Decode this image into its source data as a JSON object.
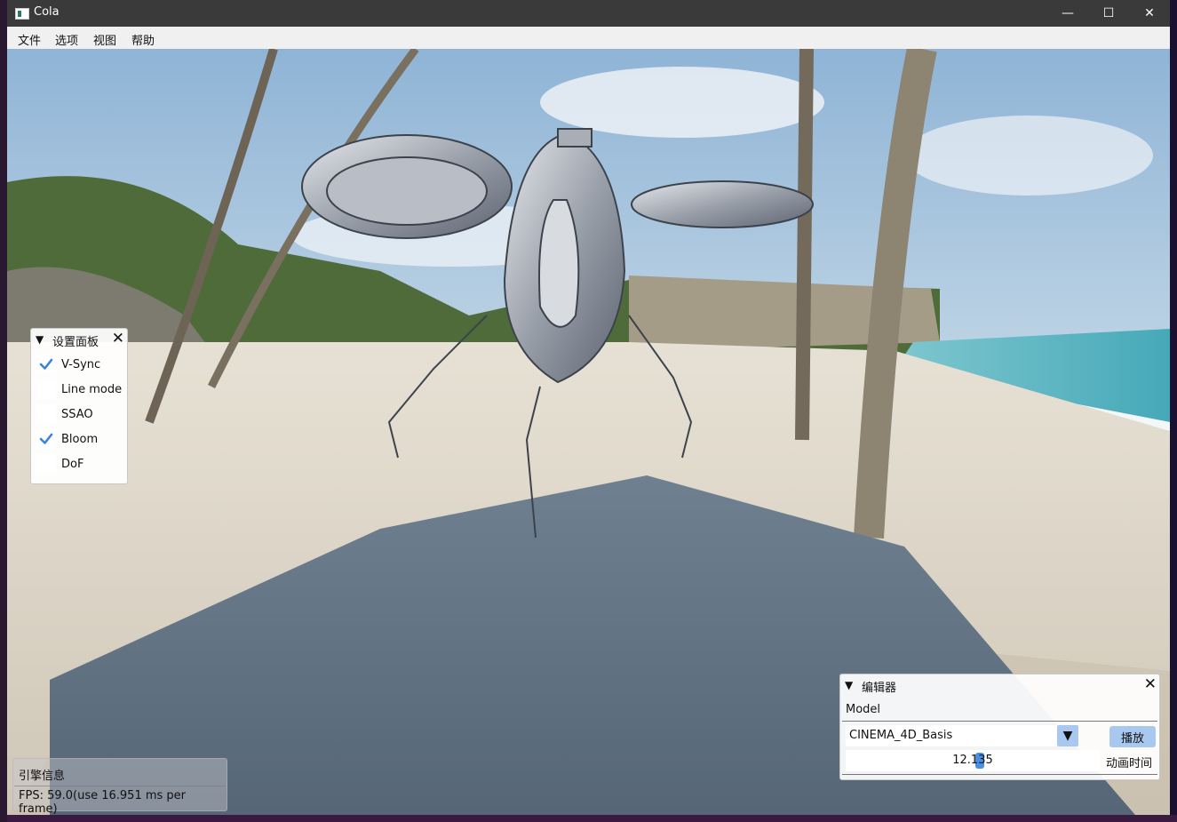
{
  "window": {
    "title": "Cola",
    "minimize_glyph": "—",
    "maximize_glyph": "☐",
    "close_glyph": "✕"
  },
  "menu": [
    "文件",
    "选项",
    "视图",
    "帮助"
  ],
  "settings_panel": {
    "title": "设置面板",
    "items": [
      {
        "label": "V-Sync",
        "checked": true
      },
      {
        "label": "Line mode",
        "checked": false
      },
      {
        "label": "SSAO",
        "checked": false
      },
      {
        "label": "Bloom",
        "checked": true
      },
      {
        "label": "DoF",
        "checked": false
      }
    ]
  },
  "editor_panel": {
    "title": "编辑器",
    "model_label": "Model",
    "model_selected": "CINEMA_4D_Basis",
    "play_label": "播放",
    "anim_time_value": "12.135",
    "anim_time_fraction": 0.53,
    "anim_time_label": "动画时间"
  },
  "engine_info": {
    "title": "引擎信息",
    "fps_text": "FPS: 59.0(use 16.951 ms per frame)"
  },
  "colors": {
    "accent": "#4a90e2",
    "button": "#a8c8f0",
    "check": "#3a84d8"
  },
  "icons": [
    "app-icon",
    "collapse-triangle-icon",
    "close-icon",
    "checkmark-icon",
    "dropdown-arrow-icon"
  ]
}
